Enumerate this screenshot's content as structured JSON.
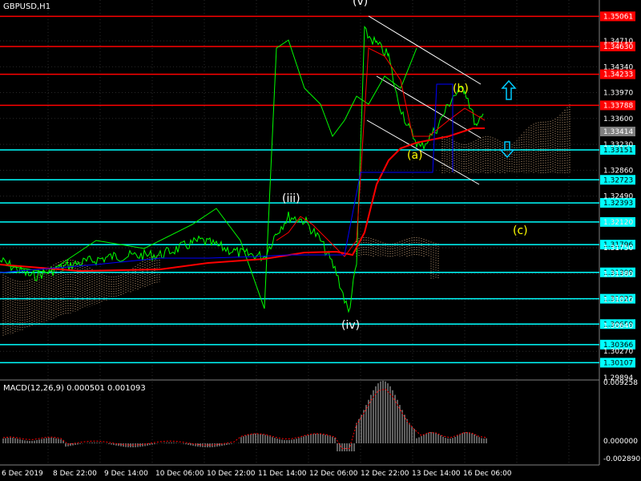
{
  "window": {
    "title": "GBPUSD,H1"
  },
  "colors": {
    "red_level": "#ff0000",
    "cyan_level": "#00ffff",
    "candle": "#00ff00",
    "ma_red": "#ff0000",
    "blue_line": "#0000ff",
    "cloud": "#c8a27a",
    "macd_hist": "#c0c0c0",
    "macd_signal": "#ff0000",
    "wave_label_white": "#ffffff",
    "wave_label_yellow": "#ffff00",
    "arrow": "#00ccff"
  },
  "main_axis": {
    "ticks": [
      "1.34710",
      "1.34340",
      "1.33970",
      "1.33600",
      "1.33230",
      "1.32860",
      "1.32490",
      "1.32120",
      "1.31750",
      "1.31380",
      "1.31010",
      "1.30640",
      "1.30270"
    ],
    "level_labels_red": [
      "1.35061",
      "1.34630",
      "1.34233",
      "1.33788"
    ],
    "level_labels_cyan": [
      "1.33151",
      "1.32723",
      "1.32393",
      "1.32120",
      "1.31796",
      "1.31399",
      "1.31022",
      "1.30659",
      "1.30366",
      "1.30107"
    ],
    "current_price": "1.33414",
    "bottom_label": "1.29894"
  },
  "wave_labels": {
    "top": "(v)",
    "iii": "(iii)",
    "iv": "(iv)",
    "a": "(a)",
    "b": "(b)",
    "c": "(c)"
  },
  "macd": {
    "title": "MACD(12,26,9) 0.000501 0.001093",
    "ticks": [
      "0.009258",
      "0.000000",
      "-0.002890"
    ]
  },
  "time_axis": {
    "labels": [
      "6 Dec 2019",
      "8 Dec 22:00",
      "9 Dec 14:00",
      "10 Dec 06:00",
      "10 Dec 22:00",
      "11 Dec 14:00",
      "12 Dec 06:00",
      "12 Dec 22:00",
      "13 Dec 14:00",
      "16 Dec 06:00"
    ]
  },
  "arrows": {
    "up": "up-arrow-icon",
    "down": "down-arrow-icon"
  }
}
